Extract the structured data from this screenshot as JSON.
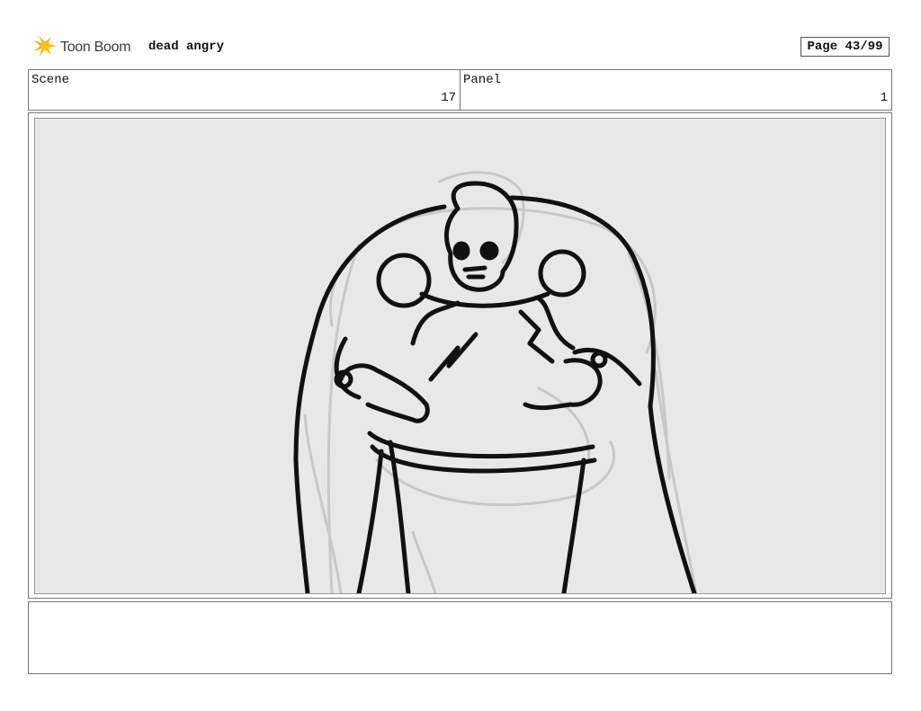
{
  "header": {
    "logo_text": "Toon Boom",
    "project_title": "dead angry",
    "page": "Page 43/99"
  },
  "info": {
    "scene_label": "Scene",
    "scene_value": "17",
    "panel_label": "Panel",
    "panel_value": "1"
  },
  "panel_image": {
    "subject": "sketch of a large caped skull-headed figure leaning forward with hands out"
  },
  "notes": {
    "text": ""
  },
  "colors": {
    "logo_star": "#f2b705",
    "sketch_line": "#111111",
    "sketch_ghost": "#c9c9c9",
    "panel_bg": "#e8e8e8"
  }
}
